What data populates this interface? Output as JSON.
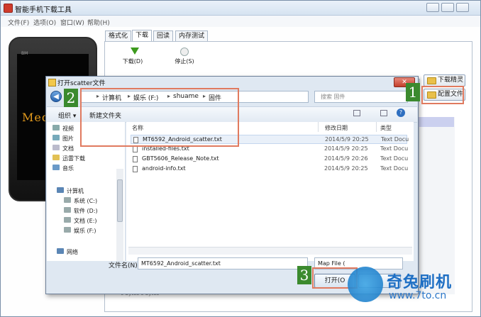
{
  "window": {
    "title": "智能手机下载工具"
  },
  "menu": [
    "文件(F)",
    "选项(O)",
    "窗口(W)",
    "帮助(H)"
  ],
  "phone": {
    "screen_text": "Med",
    "small_text": "BM"
  },
  "tabs": [
    "格式化",
    "下载",
    "回读",
    "内存测试"
  ],
  "toolbar": {
    "download_label": "下载(D)",
    "stop_label": "停止(S)"
  },
  "side_buttons": {
    "download_fine": "下载精灵",
    "config_file": "配置文件"
  },
  "dialog": {
    "title": "打开scatter文件",
    "close": "✕",
    "path": [
      "计算机",
      "娱乐 (F:)",
      "shuame",
      "固件"
    ],
    "search_placeholder": "搜索 固件",
    "organize": "组织 ▾",
    "new_folder": "新建文件夹",
    "nav_items": [
      "视频",
      "图片",
      "文档",
      "迅雷下载",
      "音乐",
      "计算机",
      "系统 (C:)",
      "软件 (D:)",
      "文档 (E:)",
      "娱乐 (F:)",
      "网络"
    ],
    "columns": {
      "name": "名称",
      "date": "修改日期",
      "type": "类型"
    },
    "files": [
      {
        "name": "MT6592_Android_scatter.txt",
        "date": "2014/5/9 20:25",
        "type": "Text Docu"
      },
      {
        "name": "installed-files.txt",
        "date": "2014/5/9 20:25",
        "type": "Text Docu"
      },
      {
        "name": "GBT5606_Release_Note.txt",
        "date": "2014/5/9 20:26",
        "type": "Text Docu"
      },
      {
        "name": "android-info.txt",
        "date": "2014/5/9 20:25",
        "type": "Text Docu"
      }
    ],
    "filename_label": "文件名(N):",
    "filename_value": "MT6592_Android_scatter.txt",
    "filter_value": "Map File (",
    "open_button": "打开(O",
    "cancel_button": ""
  },
  "annotations": [
    "1",
    "2",
    "3"
  ],
  "watermark": {
    "title": "奇兔刷机",
    "url": "www.7to.cn"
  },
  "background_fragments": {
    "strip": "0 bytes      0 bytes"
  }
}
